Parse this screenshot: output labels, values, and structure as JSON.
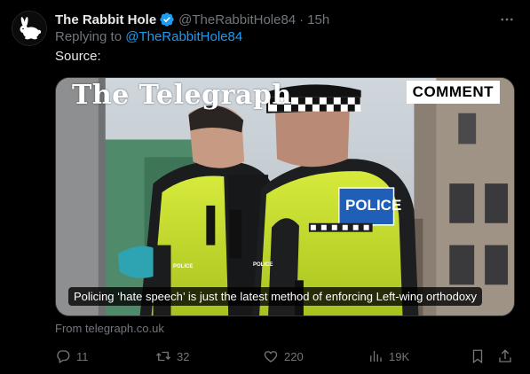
{
  "author": {
    "display_name": "The Rabbit Hole",
    "handle": "@TheRabbitHole84",
    "dot": "·",
    "time": "15h",
    "verified": true,
    "avatar_icon": "rabbit-logo"
  },
  "reply": {
    "prefix": "Replying to ",
    "mention": "@TheRabbitHole84"
  },
  "text": "Source:",
  "card": {
    "masthead": "The Telegraph",
    "badge": "COMMENT",
    "caption": "Policing ‘hate speech’ is just the latest method of enforcing Left-wing orthodoxy",
    "vest_text_1": "POLICE",
    "vest_text_2": "POLICE",
    "vest_text_3": "POLICE",
    "source": "From telegraph.co.uk"
  },
  "actions": {
    "replies": "11",
    "reposts": "32",
    "likes": "220",
    "views": "19K"
  },
  "colors": {
    "background": "#000000",
    "text": "#e7e9ea",
    "muted": "#71767b",
    "accent": "#1d9bf0",
    "hi_vis": "#c8e028",
    "police_blue": "#1f5fb8"
  }
}
